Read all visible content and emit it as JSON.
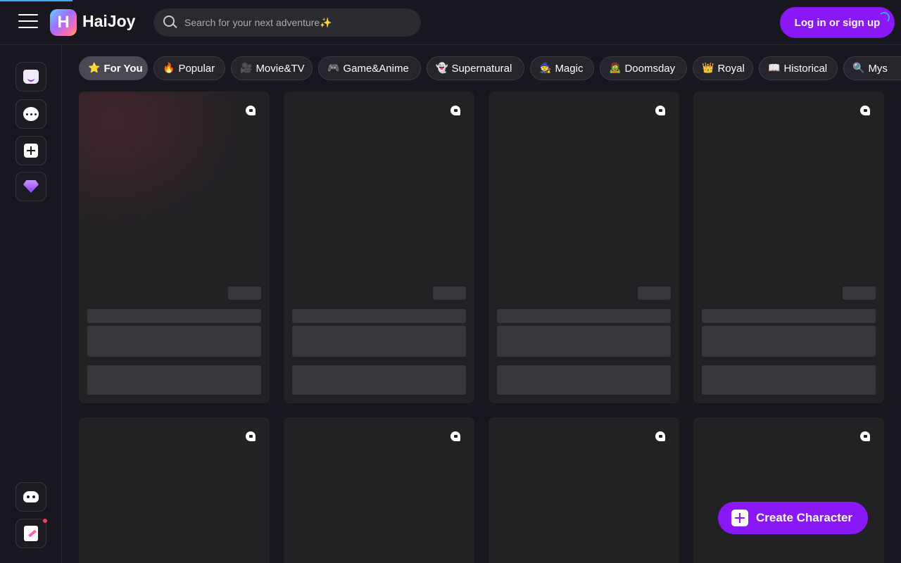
{
  "app": {
    "name": "HaiJoy",
    "logo_letter": "H"
  },
  "header": {
    "search_placeholder": "Search for your next adventure✨",
    "login_label": "Log in or sign up"
  },
  "sidebar": {
    "items": [
      {
        "name": "home",
        "icon": "home-icon"
      },
      {
        "name": "chat",
        "icon": "chat-icon"
      },
      {
        "name": "create",
        "icon": "plus-square-icon"
      },
      {
        "name": "premium",
        "icon": "gem-icon"
      }
    ],
    "bottom_items": [
      {
        "name": "discord",
        "icon": "discord-icon"
      },
      {
        "name": "notes",
        "icon": "notes-icon",
        "has_notification": true
      }
    ]
  },
  "tabs": [
    {
      "emoji": "⭐",
      "label": "For You",
      "active": true
    },
    {
      "emoji": "🔥",
      "label": "Popular"
    },
    {
      "emoji": "🎥",
      "label": "Movie&TV"
    },
    {
      "emoji": "🎮",
      "label": "Game&Anime"
    },
    {
      "emoji": "👻",
      "label": "Supernatural"
    },
    {
      "emoji": "🧙",
      "label": "Magic"
    },
    {
      "emoji": "🧟",
      "label": "Doomsday"
    },
    {
      "emoji": "👑",
      "label": "Royal"
    },
    {
      "emoji": "📖",
      "label": "Historical"
    },
    {
      "emoji": "🔍",
      "label": "Mys"
    }
  ],
  "cards": {
    "state": "loading",
    "icon": "helmet-icon"
  },
  "create_character": {
    "label": "Create Character"
  },
  "colors": {
    "background": "#18171f",
    "accent": "#8a17f5",
    "card": "#222225",
    "skeleton": "#36363b",
    "loading_bar": "#3fa9f5"
  }
}
